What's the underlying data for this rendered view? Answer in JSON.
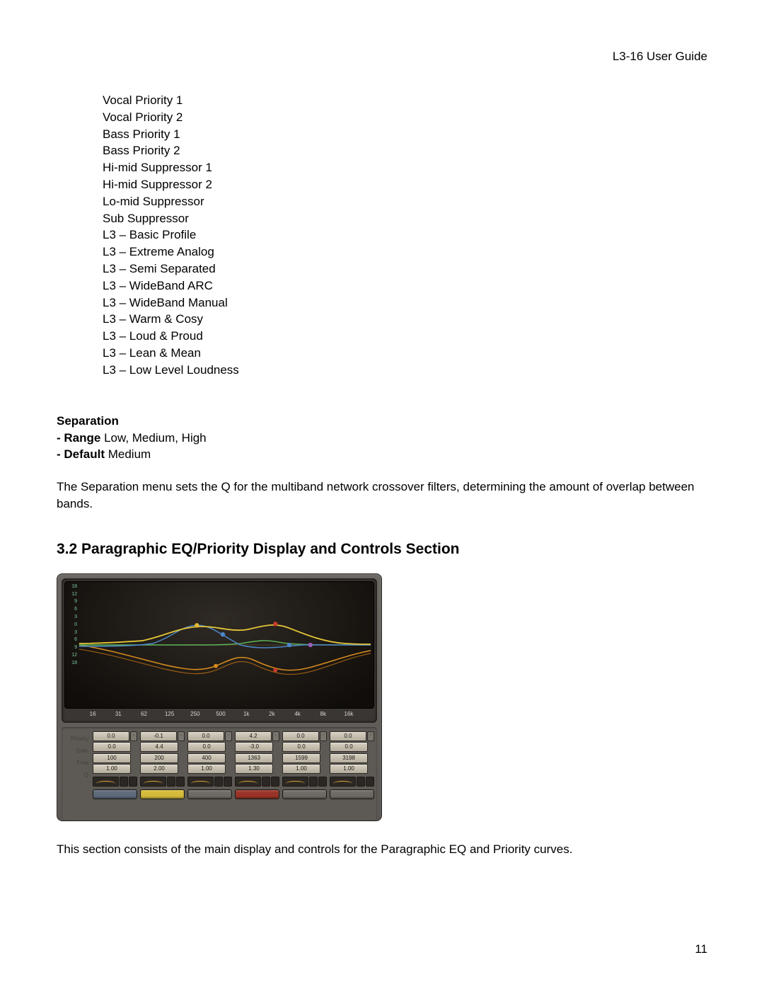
{
  "header": {
    "guide_title": "L3-16 User Guide"
  },
  "presets": [
    "Vocal Priority 1",
    "Vocal Priority 2",
    "Bass Priority 1",
    "Bass Priority 2",
    "Hi-mid Suppressor 1",
    "Hi-mid Suppressor 2",
    "Lo-mid Suppressor",
    "Sub Suppressor",
    "L3 – Basic Profile",
    "L3 – Extreme Analog",
    "L3 – Semi Separated",
    "L3 – WideBand ARC",
    "L3 – WideBand Manual",
    "L3 – Warm & Cosy",
    "L3 – Loud & Proud",
    "L3 – Lean & Mean",
    "L3 – Low Level Loudness"
  ],
  "separation": {
    "heading": "Separation",
    "range_label": "- Range",
    "range_value": " Low, Medium, High",
    "default_label": "- Default",
    "default_value": " Medium",
    "description": "The Separation menu sets the Q for the multiband network crossover filters, determining the amount of overlap between bands."
  },
  "section": {
    "heading": "3.2 Paragraphic EQ/Priority Display and Controls Section",
    "caption": "This section consists of the main display and controls for the Paragraphic EQ and Priority curves."
  },
  "plugin": {
    "db_scale": [
      "18",
      "12",
      "9",
      "6",
      "3",
      "0",
      "3",
      "6",
      "9",
      "12",
      "18"
    ],
    "freqs": [
      "16",
      "31",
      "62",
      "125",
      "250",
      "500",
      "1k",
      "2k",
      "4k",
      "8k",
      "16k"
    ],
    "row_labels": [
      "Priority",
      "Gain",
      "Freq",
      "Q"
    ],
    "bands": [
      {
        "priority": "0.0",
        "gain": "0.0",
        "freq": "100",
        "q": "1.00",
        "btn_class": "btn-blue"
      },
      {
        "priority": "-0.1",
        "gain": "4.4",
        "freq": "200",
        "q": "2.00",
        "btn_class": "btn-yellow"
      },
      {
        "priority": "0.0",
        "gain": "0.0",
        "freq": "400",
        "q": "1.00",
        "btn_class": "btn-gray"
      },
      {
        "priority": "4.2",
        "gain": "-3.0",
        "freq": "1363",
        "q": "1.30",
        "btn_class": "btn-red"
      },
      {
        "priority": "0.0",
        "gain": "0.0",
        "freq": "1599",
        "q": "1.00",
        "btn_class": "btn-gray"
      },
      {
        "priority": "0.0",
        "gain": "0.0",
        "freq": "3198",
        "q": "1.00",
        "btn_class": "btn-gray"
      }
    ]
  },
  "page_number": "11"
}
